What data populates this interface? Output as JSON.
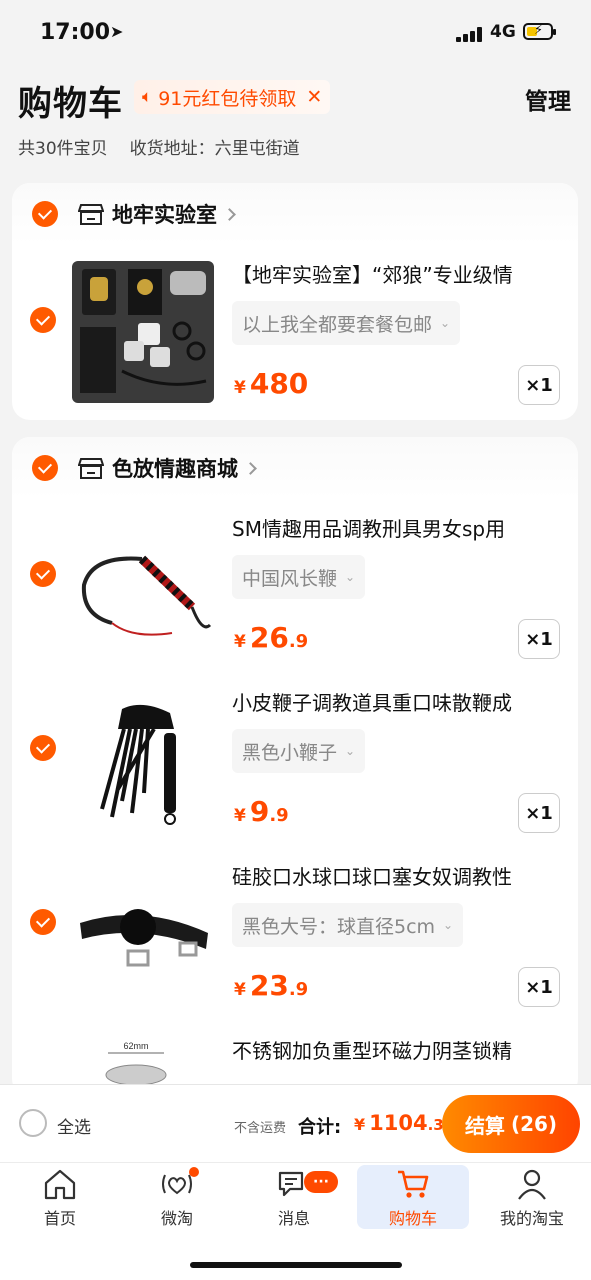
{
  "status": {
    "time": "17:00",
    "network": "4G"
  },
  "header": {
    "title": "购物车",
    "promo": "91元红包待领取",
    "manage": "管理",
    "count_text": "共30件宝贝",
    "address": "收货地址：六里屯街道"
  },
  "shops": [
    {
      "name": "地牢实验室",
      "items": [
        {
          "title": "【地牢实验室】“郊狼”专业级情",
          "sku": "以上我全都要套餐包邮",
          "currency": "¥",
          "price_int": "480",
          "price_dec": "",
          "qty": "×1"
        }
      ]
    },
    {
      "name": "色放情趣商城",
      "items": [
        {
          "title": "SM情趣用品调教刑具男女sp用",
          "sku": "中国风长鞭",
          "currency": "¥",
          "price_int": "26",
          "price_dec": ".9",
          "qty": "×1"
        },
        {
          "title": "小皮鞭子调教道具重口味散鞭成",
          "sku": "黑色小鞭子",
          "currency": "¥",
          "price_int": "9",
          "price_dec": ".9",
          "qty": "×1"
        },
        {
          "title": "硅胶口水球口球口塞女奴调教性",
          "sku": "黑色大号：球直径5cm",
          "currency": "¥",
          "price_int": "23",
          "price_dec": ".9",
          "qty": "×1"
        },
        {
          "title": "不锈钢加负重型环磁力阴茎锁精",
          "thumb_label": "62mm"
        }
      ]
    }
  ],
  "checkout": {
    "select_all": "全选",
    "shipping_note": "不含运费",
    "total_label": "合计:",
    "currency": "¥",
    "total_int": "1104",
    "total_dec": ".3",
    "pay_label": "结算",
    "pay_count": "(26)"
  },
  "tabs": [
    {
      "label": "首页",
      "icon": "home-icon"
    },
    {
      "label": "微淘",
      "icon": "weitao-icon"
    },
    {
      "label": "消息",
      "icon": "message-icon",
      "badge": "···"
    },
    {
      "label": "购物车",
      "icon": "cart-icon"
    },
    {
      "label": "我的淘宝",
      "icon": "profile-icon"
    }
  ],
  "colors": {
    "accent": "#ff4a00",
    "gradient_start": "#ff8a00",
    "active_tab_bg": "#e6eefc"
  }
}
